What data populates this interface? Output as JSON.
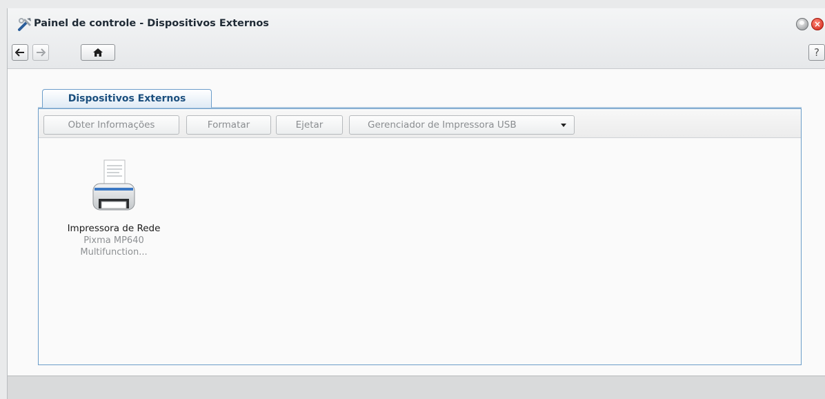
{
  "window": {
    "title": "Painel de controle - Dispositivos Externos",
    "app_icon": "tools-icon"
  },
  "nav": {
    "back_icon": "arrow-left-icon",
    "forward_icon": "arrow-right-icon",
    "home_icon": "home-icon",
    "help_label": "?"
  },
  "tabs": [
    {
      "label": "Dispositivos Externos",
      "active": true
    }
  ],
  "toolbar": {
    "info_label": "Obter Informações",
    "format_label": "Formatar",
    "eject_label": "Ejetar",
    "usb_label": "Gerenciador de Impressora USB"
  },
  "devices": [
    {
      "icon": "printer-icon",
      "name": "Impressora de Rede",
      "model": "Pixma MP640 Multifunction..."
    }
  ],
  "colors": {
    "accent": "#6a9cc9",
    "tab_text": "#1b4f7e",
    "close": "#cf1f12"
  }
}
